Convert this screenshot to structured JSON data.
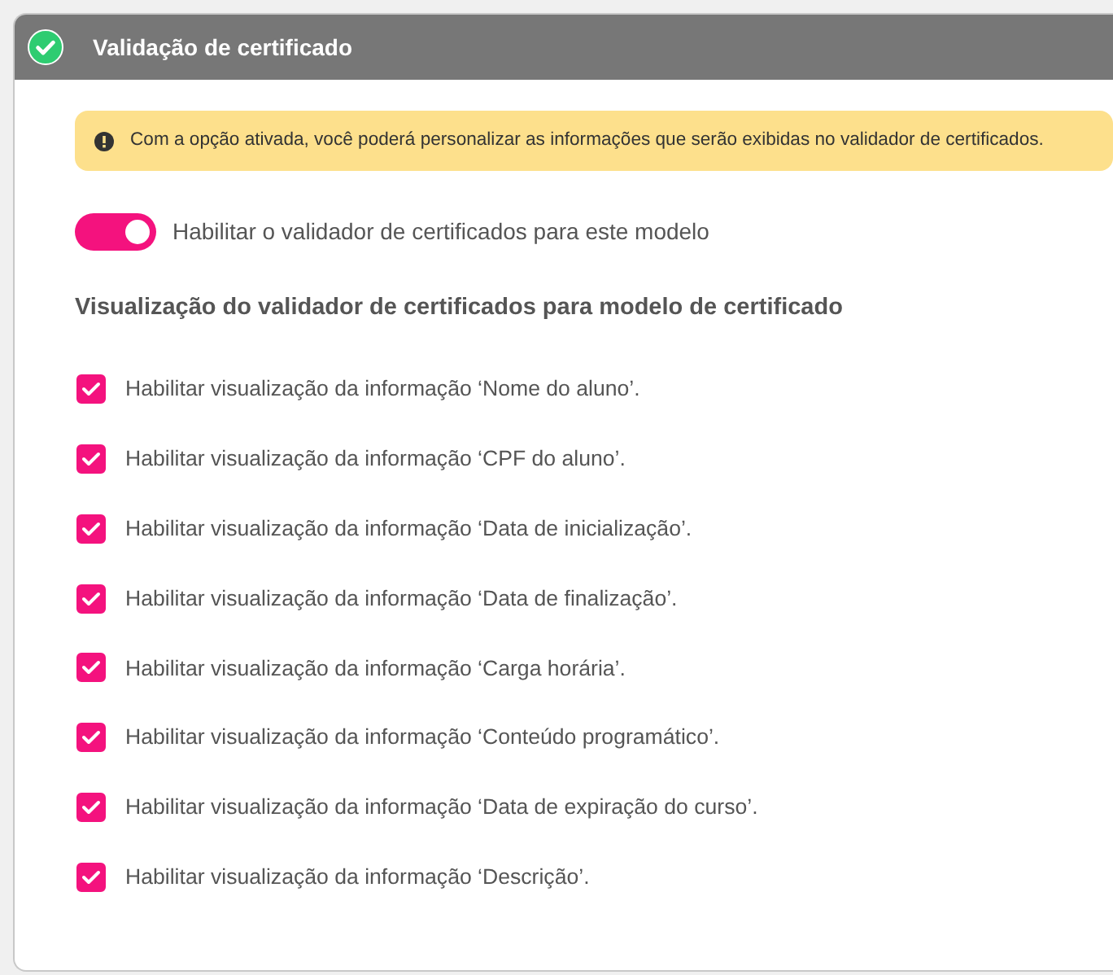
{
  "panel": {
    "title": "Validação de certificado",
    "completed": true
  },
  "alert": {
    "text": "Com a opção ativada, você poderá personalizar as informações que serão exibidas no validador de certificados."
  },
  "toggle": {
    "label": "Habilitar o validador de certificados para este modelo",
    "on": true
  },
  "section_title": "Visualização do validador de certificados para modelo de certificado",
  "options": [
    {
      "label": "Habilitar visualização da informação ‘Nome do aluno’.",
      "checked": true
    },
    {
      "label": "Habilitar visualização da informação ‘CPF do aluno’.",
      "checked": true
    },
    {
      "label": "Habilitar visualização da informação ‘Data de inicialização’.",
      "checked": true
    },
    {
      "label": "Habilitar visualização da informação ‘Data de finalização’.",
      "checked": true
    },
    {
      "label": "Habilitar visualização da informação ‘Carga horária’.",
      "checked": true
    },
    {
      "label": "Habilitar visualização da informação ‘Conteúdo programático’.",
      "checked": true
    },
    {
      "label": "Habilitar visualização da informação ‘Data de expiração do curso’.",
      "checked": true
    },
    {
      "label": "Habilitar visualização da informação ‘Descrição’.",
      "checked": true
    }
  ]
}
